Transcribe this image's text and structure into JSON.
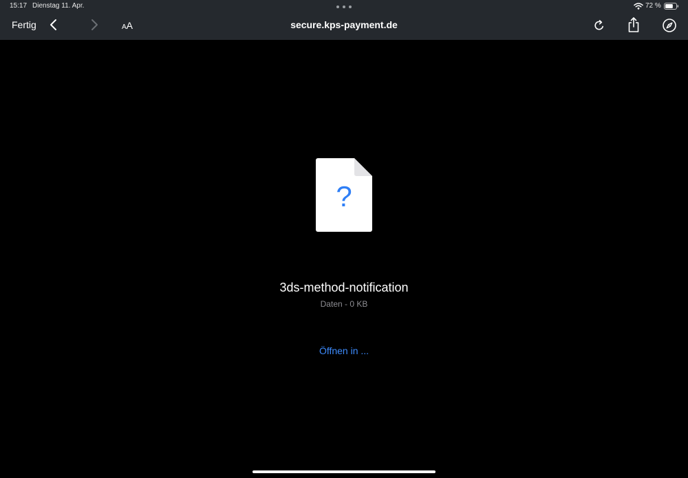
{
  "status_bar": {
    "time": "15:17",
    "date": "Dienstag 11. Apr.",
    "battery_percent_text": "72 %",
    "battery_level": 0.72
  },
  "toolbar": {
    "done_label": "Fertig",
    "text_size_small": "A",
    "text_size_large": "A",
    "url_title": "secure.kps-payment.de",
    "icons": {
      "back": "chevron-left-icon",
      "forward": "chevron-right-icon",
      "reload": "reload-icon",
      "share": "share-icon",
      "compass": "compass-icon"
    }
  },
  "file_preview": {
    "icon": "unknown-file-icon",
    "icon_symbol": "?",
    "file_name": "3ds-method-notification",
    "file_info": "Daten - 0 KB",
    "open_in_label": "Öffnen in ..."
  },
  "colors": {
    "toolbar_background": "#25292e",
    "page_background": "#000000",
    "accent": "#3d8bfd",
    "secondary_text": "#8e8e93"
  }
}
